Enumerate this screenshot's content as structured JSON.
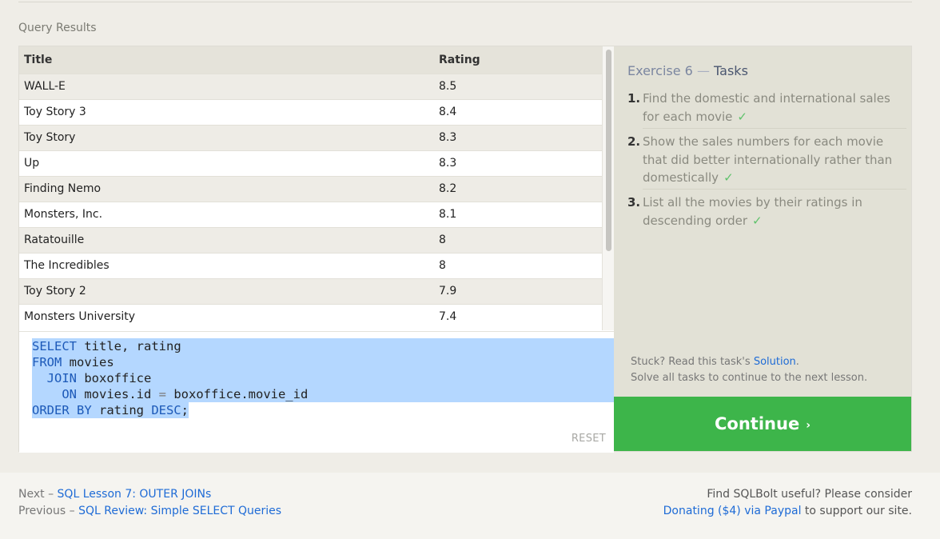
{
  "results_label": "Query Results",
  "table": {
    "headers": [
      "Title",
      "Rating"
    ],
    "rows": [
      [
        "WALL-E",
        "8.5"
      ],
      [
        "Toy Story 3",
        "8.4"
      ],
      [
        "Toy Story",
        "8.3"
      ],
      [
        "Up",
        "8.3"
      ],
      [
        "Finding Nemo",
        "8.2"
      ],
      [
        "Monsters, Inc.",
        "8.1"
      ],
      [
        "Ratatouille",
        "8"
      ],
      [
        "The Incredibles",
        "8"
      ],
      [
        "Toy Story 2",
        "7.9"
      ],
      [
        "Monsters University",
        "7.4"
      ]
    ]
  },
  "editor": {
    "lines": [
      [
        {
          "t": "SELECT",
          "c": "kw"
        },
        {
          "t": " title, rating",
          "c": ""
        }
      ],
      [
        {
          "t": "FROM",
          "c": "kw"
        },
        {
          "t": " movies",
          "c": ""
        }
      ],
      [
        {
          "t": "  ",
          "c": ""
        },
        {
          "t": "JOIN",
          "c": "kw"
        },
        {
          "t": " boxoffice",
          "c": ""
        }
      ],
      [
        {
          "t": "    ",
          "c": ""
        },
        {
          "t": "ON",
          "c": "kw"
        },
        {
          "t": " movies.id ",
          "c": ""
        },
        {
          "t": "=",
          "c": "op"
        },
        {
          "t": " boxoffice.movie_id",
          "c": ""
        }
      ],
      [
        {
          "t": "ORDER BY",
          "c": "kw"
        },
        {
          "t": " rating ",
          "c": ""
        },
        {
          "t": "DESC",
          "c": "kw"
        },
        {
          "t": ";",
          "c": ""
        }
      ]
    ],
    "reset_label": "RESET"
  },
  "tasks": {
    "title_prefix": "Exercise 6",
    "title_sep": "—",
    "title_word": "Tasks",
    "items": [
      {
        "num": "1.",
        "text": "Find the domestic and international sales for each movie",
        "done": true
      },
      {
        "num": "2.",
        "text": "Show the sales numbers for each movie that did better internationally rather than domestically",
        "done": true
      },
      {
        "num": "3.",
        "text": "List all the movies by their ratings in descending order",
        "done": true
      }
    ],
    "check_glyph": "✓",
    "stuck_prefix": "Stuck? Read this task's",
    "solution_link": "Solution",
    "stuck_suffix": ".",
    "solve_all": "Solve all tasks to continue to the next lesson."
  },
  "continue_label": "Continue",
  "continue_arrow": "›",
  "footer": {
    "next_label": "Next –",
    "next_link": "SQL Lesson 7: OUTER JOINs",
    "prev_label": "Previous –",
    "prev_link": "SQL Review: Simple SELECT Queries",
    "useful_text": "Find SQLBolt useful? Please consider",
    "donate_link": "Donating ($4) via Paypal",
    "support_text": "to support our site."
  }
}
